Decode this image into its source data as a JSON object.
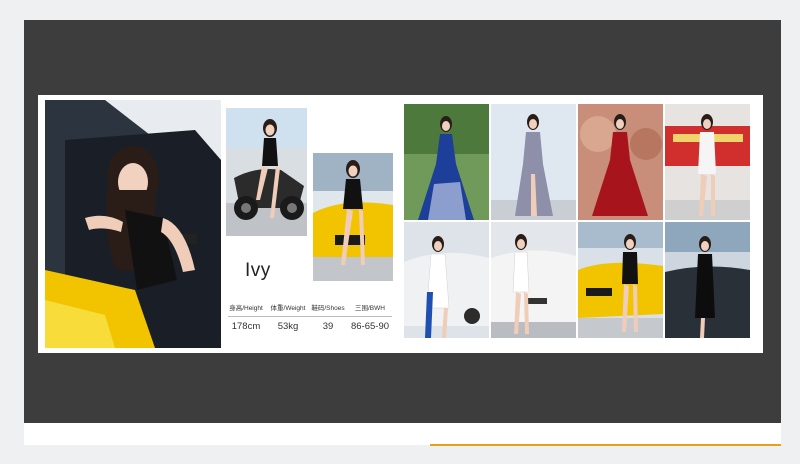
{
  "profile": {
    "name": "Ivy",
    "stats": {
      "headers": [
        "身高/Height",
        "体重/Weight",
        "鞋码/Shoes",
        "三围/BWH"
      ],
      "values": [
        "178cm",
        "53kg",
        "39",
        "86-65-90"
      ]
    }
  },
  "colors": {
    "frame": "#3d3d3d",
    "card": "#ffffff",
    "accent": "#e3a21a",
    "page": "#eef0f2"
  },
  "photos": [
    "photo-woman-in-car",
    "photo-woman-on-motorcycle",
    "photo-woman-by-yellow-car",
    "photo-blue-gown",
    "photo-grey-gown",
    "photo-red-gown",
    "photo-white-dress-red-backdrop",
    "photo-white-dress-silver-car",
    "photo-white-dress-ev",
    "photo-black-dress-yellow-car",
    "photo-black-dress-dark-car"
  ]
}
